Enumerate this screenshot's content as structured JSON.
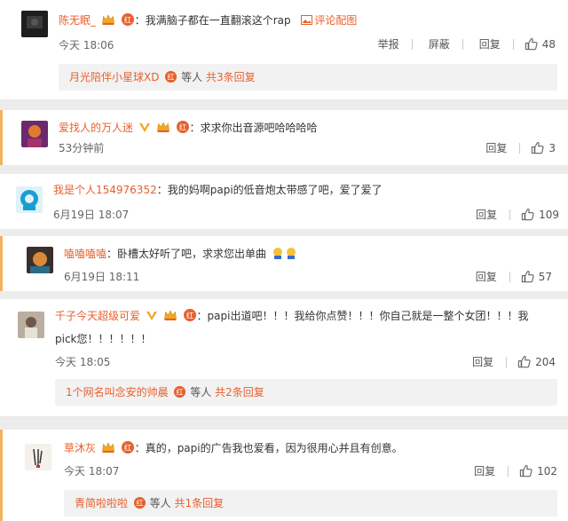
{
  "comments": [
    {
      "username": "陈无眠_",
      "text": "我满脑子都在一直翻滚这个rap",
      "extra_link": "评论配图",
      "time": "今天 18:06",
      "report": "举报",
      "block": "屏蔽",
      "reply": "回复",
      "likes": "48",
      "sub_replier": "月光陪伴小星球XD",
      "sub_etc": "等人",
      "sub_count": "共3条回复"
    },
    {
      "username": "爱找人的万人迷",
      "text": "求求你出音源吧哈哈哈哈",
      "time": "53分钟前",
      "reply": "回复",
      "likes": "3"
    },
    {
      "username": "我是个人154976352",
      "text": "我的妈啊papi的低音炮太带感了吧，爱了爱了",
      "time": "6月19日 18:07",
      "reply": "回复",
      "likes": "109"
    },
    {
      "username": "嗑嗑嗑嗑",
      "text": "卧槽太好听了吧，求求您出单曲",
      "time": "6月19日 18:11",
      "reply": "回复",
      "likes": "57"
    },
    {
      "username": "千子今天超级可爱",
      "text_line1": "papi出道吧！！！我给你点赞！！！你自己就是一整个女团！！！我",
      "text_line2": "pick您！！！！！！",
      "time": "今天 18:05",
      "reply": "回复",
      "likes": "204",
      "sub_replier": "1个网名叫念安的帅晨",
      "sub_etc": "等人",
      "sub_count": "共2条回复"
    },
    {
      "username": "草沐灰",
      "text": "真的，papi的广告我也爱看，因为很用心并且有创意。",
      "time": "今天 18:07",
      "reply": "回复",
      "likes": "102",
      "sub_replier": "青简啦啦啦",
      "sub_etc": "等人",
      "sub_count": "共1条回复"
    }
  ],
  "colors": {
    "username": "#e8602c",
    "accent": "#f2b35e",
    "background": "#ececec"
  },
  "icons": [
    "thumb-up-icon",
    "vip-crown-icon",
    "member-badge-icon",
    "image-icon"
  ]
}
